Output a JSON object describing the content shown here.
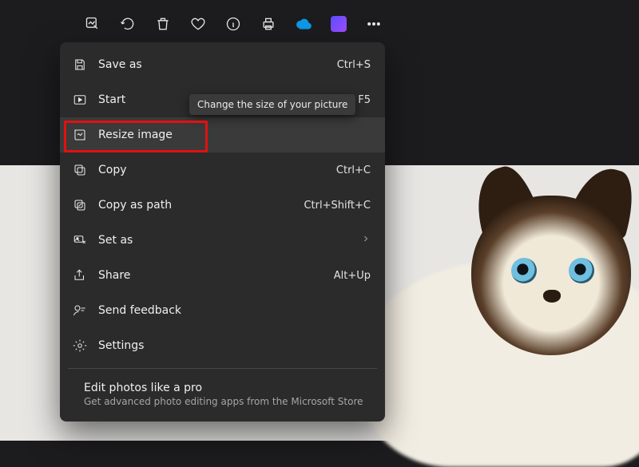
{
  "toolbar": {
    "icons": [
      "edit-image-icon",
      "rotate-icon",
      "delete-icon",
      "favorite-icon",
      "info-icon",
      "print-icon",
      "cloud-icon",
      "ms-store-icon",
      "more-icon"
    ]
  },
  "menu": {
    "save_as": {
      "label": "Save as",
      "shortcut": "Ctrl+S"
    },
    "start_slideshow": {
      "label": "Start",
      "shortcut": "F5"
    },
    "resize": {
      "label": "Resize image"
    },
    "copy": {
      "label": "Copy",
      "shortcut": "Ctrl+C"
    },
    "copy_as_path": {
      "label": "Copy as path",
      "shortcut": "Ctrl+Shift+C"
    },
    "set_as": {
      "label": "Set as"
    },
    "share": {
      "label": "Share",
      "shortcut": "Alt+Up"
    },
    "send_feedback": {
      "label": "Send feedback"
    },
    "settings": {
      "label": "Settings"
    },
    "promo": {
      "title": "Edit photos like a pro",
      "subtitle": "Get advanced photo editing apps from the Microsoft Store"
    }
  },
  "tooltip": {
    "text": "Change the size of your picture"
  },
  "annotation": {
    "highlighted_item": "resize-image"
  }
}
